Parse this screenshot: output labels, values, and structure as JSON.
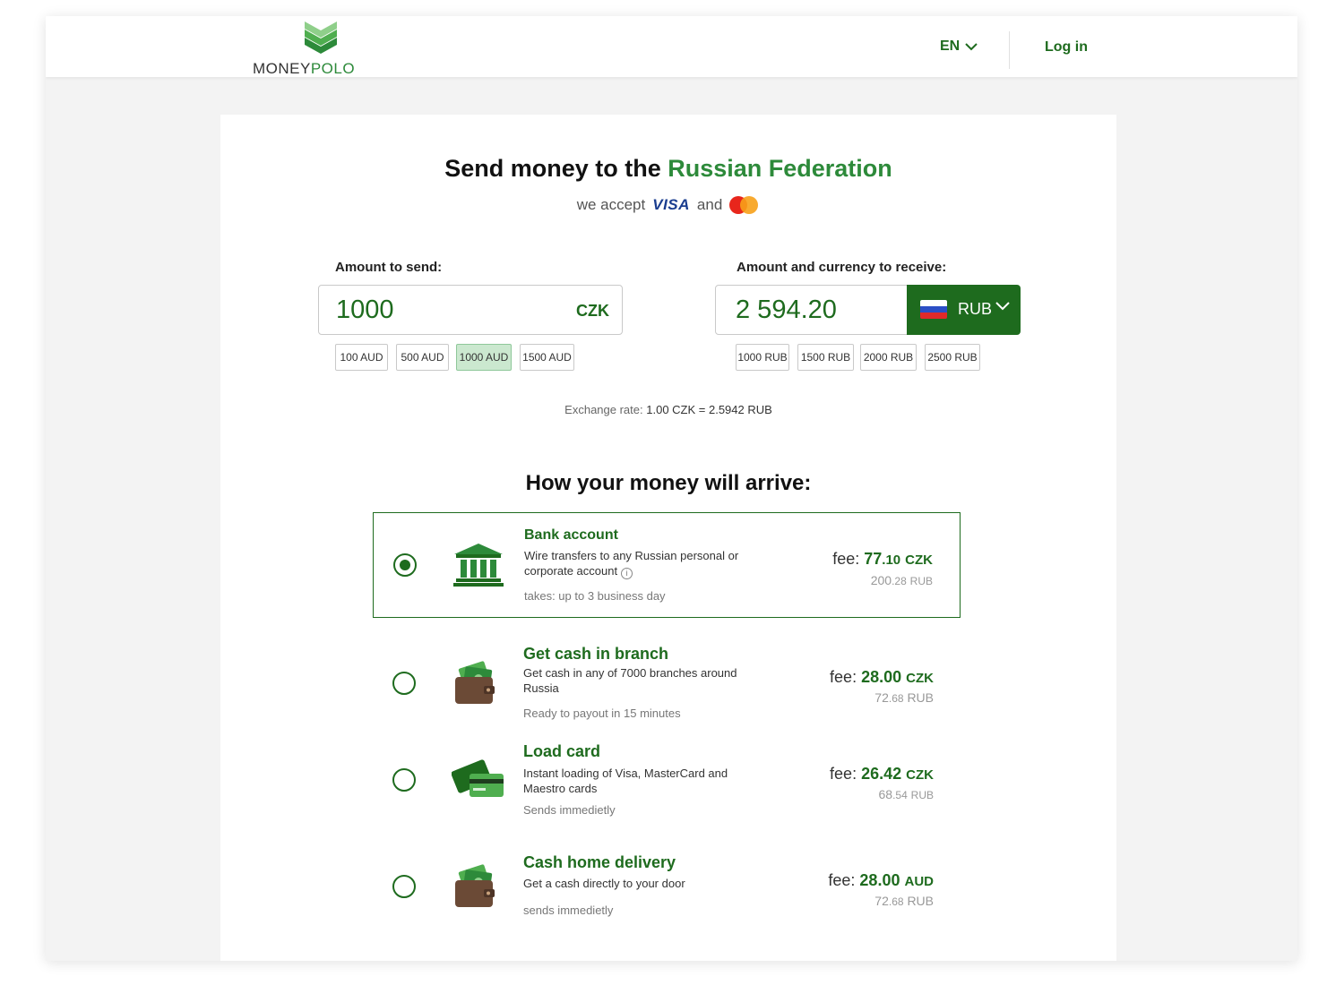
{
  "header": {
    "logo": {
      "part1": "MONEY",
      "part2": "POLO"
    },
    "lang": "EN",
    "login": "Log in"
  },
  "hero": {
    "title_prefix": "Send money to the",
    "country": "Russian Federation",
    "accept_prefix": "we accept",
    "visa": "VISA",
    "accept_and": "and"
  },
  "send": {
    "label": "Amount to send:",
    "value": "1000",
    "currency": "CZK",
    "presets": [
      {
        "label": "100 AUD",
        "active": false
      },
      {
        "label": "500 AUD",
        "active": false
      },
      {
        "label": "1000 AUD",
        "active": true
      },
      {
        "label": "1500 AUD",
        "active": false
      }
    ]
  },
  "receive": {
    "label": "Amount and currency to receive:",
    "value": "2 594.20",
    "currency": "RUB",
    "presets": [
      {
        "label": "1000 RUB"
      },
      {
        "label": "1500 RUB"
      },
      {
        "label": "2000 RUB"
      },
      {
        "label": "2500 RUB"
      }
    ]
  },
  "rate": {
    "label": "Exchange rate:",
    "value": "1.00 CZK = 2.5942 RUB"
  },
  "arrival": {
    "title": "How your money will arrive:",
    "options": [
      {
        "icon": "bank-icon",
        "title": "Bank account",
        "description": "Wire transfers to any Russian personal or corporate account",
        "time": "takes: up to 3 business day",
        "fee_label": "fee:",
        "fee_int": "77",
        "fee_dec": ".10",
        "fee_currency": "CZK",
        "sub_int": "200",
        "sub_dec": ".28",
        "sub_currency": "RUB",
        "selected": true
      },
      {
        "icon": "wallet-icon",
        "title": "Get cash in branch",
        "description": "Get cash in any of 7000 branches around Russia",
        "time": "Ready to payout in 15 minutes",
        "fee_label": "fee:",
        "fee_int": "28",
        "fee_dec": ".00",
        "fee_currency": "CZK",
        "sub_int": "72",
        "sub_dec": ".68",
        "sub_currency": "RUB",
        "selected": false
      },
      {
        "icon": "cards-icon",
        "title": "Load card",
        "description": "Instant loading of Visa, MasterCard and Maestro cards",
        "time": "Sends immedietly",
        "fee_label": "fee:",
        "fee_int": "26",
        "fee_dec": ".42",
        "fee_currency": "CZK",
        "sub_int": "68",
        "sub_dec": ".54",
        "sub_currency": "RUB",
        "selected": false
      },
      {
        "icon": "wallet-icon",
        "title": "Cash home delivery",
        "description": "Get a cash directly to your door",
        "time": "sends immedietly",
        "fee_label": "fee:",
        "fee_int": "28",
        "fee_dec": ".00",
        "fee_currency": "AUD",
        "sub_int": "72",
        "sub_dec": ".68",
        "sub_currency": "RUB",
        "selected": false
      }
    ]
  },
  "colors": {
    "brand_green": "#1e6b1e",
    "accent_green": "#2d8a3a",
    "preset_active": "#cbe8cf"
  }
}
